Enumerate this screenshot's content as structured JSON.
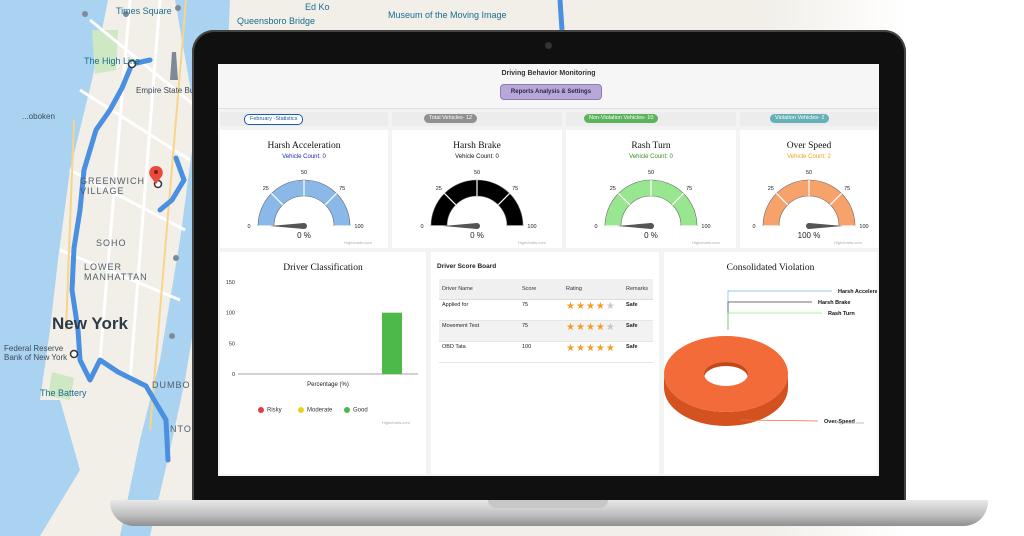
{
  "map": {
    "labels": {
      "times_square": "Times Square",
      "ed_koch": "Ed Ko",
      "queensboro": "Queensboro Bridge",
      "museum": "Museum of the Moving Image",
      "high_line": "The High Line",
      "empire": "Empire State Building",
      "greenwich": "GREENWICH VILLAGE",
      "soho": "SOHO",
      "lower_manhattan": "LOWER MANHATTAN",
      "new_york": "New York",
      "federal_reserve": "Federal Reserve Bank of New York",
      "battery": "The Battery",
      "dumbo": "DUMBO",
      "hoboken_partial": "...oboken",
      "tunnel_partial": "NTO"
    },
    "colors": {
      "route": "#4a8fe0",
      "water": "#aad3f2",
      "land": "#f2efe9",
      "pin": "#e84b3c"
    }
  },
  "app": {
    "title": "Driving Behavior Monitoring",
    "reports_button": "Reports Analysis & Settings"
  },
  "stats": [
    {
      "label": "February -Statistics",
      "color": "#1a5ab0",
      "fill": "#ffffff"
    },
    {
      "label": "Total Vehicles- 12",
      "color": "#ffffff",
      "fill": "#909090"
    },
    {
      "label": "Non-Violation Vehicles- 10",
      "color": "#ffffff",
      "fill": "#5db35d"
    },
    {
      "label": "Violation Vehicles- 2",
      "color": "#ffffff",
      "fill": "#66b0b8"
    }
  ],
  "gauges": [
    {
      "title": "Harsh Acceleration",
      "count_label": "Vehicle Count: 0",
      "count_color": "#1a2bb8",
      "value_label": "0 %",
      "value": 0,
      "color": "#8ab8e8",
      "ticks": [
        "0",
        "25",
        "50",
        "75",
        "100"
      ]
    },
    {
      "title": "Harsh Brake",
      "count_label": "Vehicle Count: 0",
      "count_color": "#111111",
      "value_label": "0 %",
      "value": 0,
      "color": "#000000",
      "ticks": [
        "0",
        "25",
        "50",
        "75",
        "100"
      ]
    },
    {
      "title": "Rash Turn",
      "count_label": "Vehicle Count: 0",
      "count_color": "#3b8f20",
      "value_label": "0 %",
      "value": 0,
      "color": "#99e690",
      "ticks": [
        "0",
        "25",
        "50",
        "75",
        "100"
      ]
    },
    {
      "title": "Over Speed",
      "count_label": "Vehicle Count: 2",
      "count_color": "#e8a417",
      "value_label": "100 %",
      "value": 100,
      "color": "#f7a26a",
      "ticks": [
        "0",
        "25",
        "50",
        "75",
        "100"
      ]
    }
  ],
  "credit": "Highcharts.com",
  "classification": {
    "title": "Driver Classification",
    "xlabel": "Percentage (%)",
    "legend": [
      {
        "name": "Risky",
        "color": "#e63946"
      },
      {
        "name": "Moderate",
        "color": "#e6d21c"
      },
      {
        "name": "Good",
        "color": "#4cb94a"
      }
    ]
  },
  "scoreboard": {
    "title": "Driver Score Board",
    "headers": [
      "Driver Name",
      "Score",
      "Rating",
      "Remarks"
    ],
    "rows": [
      {
        "name": "Applied for",
        "score": "75",
        "stars": 4,
        "remarks": "Safe"
      },
      {
        "name": "Movement Test",
        "score": "75",
        "stars": 4,
        "remarks": "Safe"
      },
      {
        "name": "OBD Tata",
        "score": "100",
        "stars": 5,
        "remarks": "Safe"
      }
    ]
  },
  "violation": {
    "title": "Consolidated Violation",
    "labels": [
      "Harsh Acceleration",
      "Harsh Brake",
      "Rash Turn",
      "Over-Speed"
    ]
  },
  "chart_data": [
    {
      "type": "bar",
      "title": "Driver Classification",
      "xlabel": "Percentage (%)",
      "ylabel": "",
      "ylim": [
        0,
        150
      ],
      "yticks": [
        0,
        50,
        100,
        150
      ],
      "categories": [
        "Risky",
        "Moderate",
        "Good"
      ],
      "series": [
        {
          "name": "Risky",
          "values": [
            0
          ],
          "color": "#e63946"
        },
        {
          "name": "Moderate",
          "values": [
            0
          ],
          "color": "#e6d21c"
        },
        {
          "name": "Good",
          "values": [
            100
          ],
          "color": "#4cb94a"
        }
      ],
      "grid": false,
      "legend": "bottom"
    },
    {
      "type": "pie",
      "title": "Consolidated Violation",
      "slices": [
        {
          "label": "Harsh Acceleration",
          "value": 0,
          "color": "#7cb5ec"
        },
        {
          "label": "Harsh Brake",
          "value": 0,
          "color": "#434348"
        },
        {
          "label": "Rash Turn",
          "value": 0,
          "color": "#90ed7d"
        },
        {
          "label": "Over-Speed",
          "value": 100,
          "color": "#f26b38"
        }
      ],
      "donut": true,
      "three_d": true
    }
  ]
}
